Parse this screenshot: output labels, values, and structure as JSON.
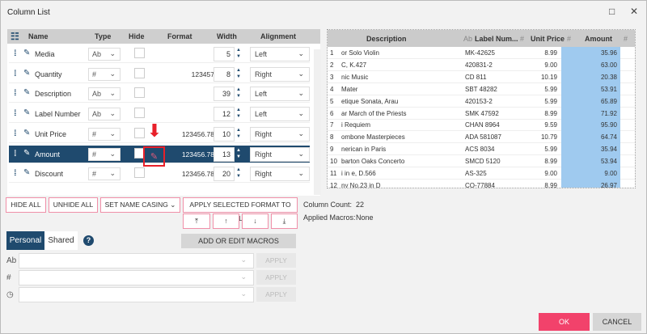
{
  "window": {
    "title": "Column List",
    "maximize_icon": "□",
    "close_icon": "✕"
  },
  "left_grid": {
    "headers": {
      "name": "Name",
      "type": "Type",
      "hide": "Hide",
      "format": "Format",
      "width": "Width",
      "alignment": "Alignment"
    },
    "rows": [
      {
        "name": "Media",
        "type": "Ab",
        "format": "",
        "width": "5",
        "alignment": "Left"
      },
      {
        "name": "Quantity",
        "type": "#",
        "format": "123457",
        "width": "8",
        "alignment": "Right"
      },
      {
        "name": "Description",
        "type": "Ab",
        "format": "",
        "width": "39",
        "alignment": "Left"
      },
      {
        "name": "Label Number",
        "type": "Ab",
        "format": "",
        "width": "12",
        "alignment": "Left"
      },
      {
        "name": "Unit Price",
        "type": "#",
        "format": "123456.78",
        "width": "10",
        "alignment": "Right"
      },
      {
        "name": "Amount",
        "type": "#",
        "format": "123456.78",
        "width": "13",
        "alignment": "Right",
        "selected": true
      },
      {
        "name": "Discount",
        "type": "#",
        "format": "123456.78",
        "width": "20",
        "alignment": "Right"
      }
    ]
  },
  "right_grid": {
    "headers": {
      "description": "Description",
      "label_prefix": "Ab",
      "label": "Label Num...",
      "unit_prefix": "#",
      "unit_price": "Unit Price",
      "amount_prefix": "#",
      "amount": "Amount",
      "extra_prefix": "#"
    },
    "rows": [
      [
        "1",
        "or Solo Violin",
        "MK-42625",
        "8.99",
        "35.96"
      ],
      [
        "2",
        "C, K.427",
        "420831-2",
        "9.00",
        "63.00"
      ],
      [
        "3",
        "nic Music",
        "CD 811",
        "10.19",
        "20.38"
      ],
      [
        "4",
        "Mater",
        "SBT 48282",
        "5.99",
        "53.91"
      ],
      [
        "5",
        "etique Sonata, Arau",
        "420153-2",
        "5.99",
        "65.89"
      ],
      [
        "6",
        "ar March of the Priests",
        "SMK 47592",
        "8.99",
        "71.92"
      ],
      [
        "7",
        "i Requiem",
        "CHAN 8964",
        "9.59",
        "95.90"
      ],
      [
        "8",
        "ombone Masterpieces",
        "ADA 581087",
        "10.79",
        "64.74"
      ],
      [
        "9",
        "nerican in Paris",
        "ACS 8034",
        "5.99",
        "35.94"
      ],
      [
        "10",
        "barton Oaks Concerto",
        "SMCD 5120",
        "8.99",
        "53.94"
      ],
      [
        "11",
        "i in e, D.566",
        "AS-325",
        "9.00",
        "9.00"
      ],
      [
        "12",
        "ny No.23 in D",
        "CO-77884",
        "8.99",
        "26.97"
      ]
    ]
  },
  "buttons": {
    "hide_all": "HIDE ALL",
    "unhide_all": "UNHIDE ALL",
    "set_name_casing": "SET NAME CASING ⌄",
    "apply_format": "APPLY SELECTED FORMAT TO ALL",
    "move_top": "⤒",
    "move_up": "↑",
    "move_down": "↓",
    "move_bottom": "⤓",
    "macros": "ADD OR EDIT MACROS",
    "apply": "APPLY",
    "ok": "OK",
    "cancel": "CANCEL"
  },
  "info": {
    "column_count_label": "Column Count:",
    "column_count": "22",
    "macros_label": "Applied Macros:",
    "macros_value": "None"
  },
  "tabs": {
    "personal": "Personal",
    "shared": "Shared",
    "help": "?"
  },
  "macro_rows": [
    {
      "icon": "Ab"
    },
    {
      "icon": "#"
    },
    {
      "icon": "◷"
    }
  ],
  "colors": {
    "accent": "#1f4a6e",
    "ok": "#f2426b",
    "highlight": "#e8202a",
    "amount_bg": "#9fcaef"
  }
}
